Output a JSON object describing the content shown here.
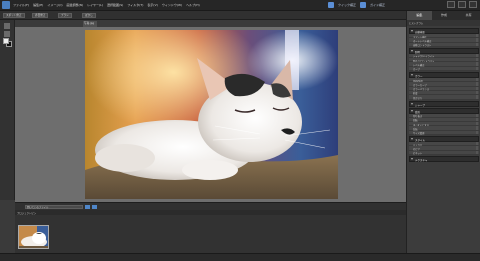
{
  "menu": [
    "ファイル(F)",
    "編集(E)",
    "イメージ(I)",
    "画質調整(N)",
    "レイヤー(L)",
    "選択範囲(S)",
    "フィルタ(T)",
    "表示(V)",
    "ウィンドウ(W)",
    "ヘルプ(H)"
  ],
  "header_links": {
    "left": "クイック補正",
    "right": "ガイド補正"
  },
  "options": [
    "スポット修正",
    "赤目修正",
    "ブラシ",
    "ぼかし"
  ],
  "document_tab": "写真.jpg",
  "project_bin": {
    "dropdown": "開いているファイル",
    "label": "プロジェクトビン"
  },
  "panel": {
    "tabs": [
      "編集",
      "作成",
      "共有"
    ],
    "subheader": "ヒストグラム",
    "sections": [
      {
        "title": "自動補正",
        "items": [
          "スマート補正",
          "オートレベル補正",
          "自動コントラスト"
        ]
      },
      {
        "title": "照明",
        "items": [
          "シャドウ/ハイライト",
          "明るさ/コントラスト",
          "レベル補正",
          "カーブ"
        ]
      },
      {
        "title": "カラー",
        "items": [
          "色相/彩度",
          "カラーカーブ",
          "カラーバランス",
          "彩度",
          "色かぶり"
        ]
      },
      {
        "title": "シャープ",
        "items": []
      },
      {
        "title": "変形",
        "items": [
          "切り抜き",
          "回転",
          "まっすぐにする",
          "反転",
          "サイズ変更"
        ]
      },
      {
        "title": "スタイル",
        "items": [
          "モノクロ",
          "セピア",
          "ビネット"
        ]
      },
      {
        "title": "テクスチャ",
        "items": []
      }
    ]
  }
}
